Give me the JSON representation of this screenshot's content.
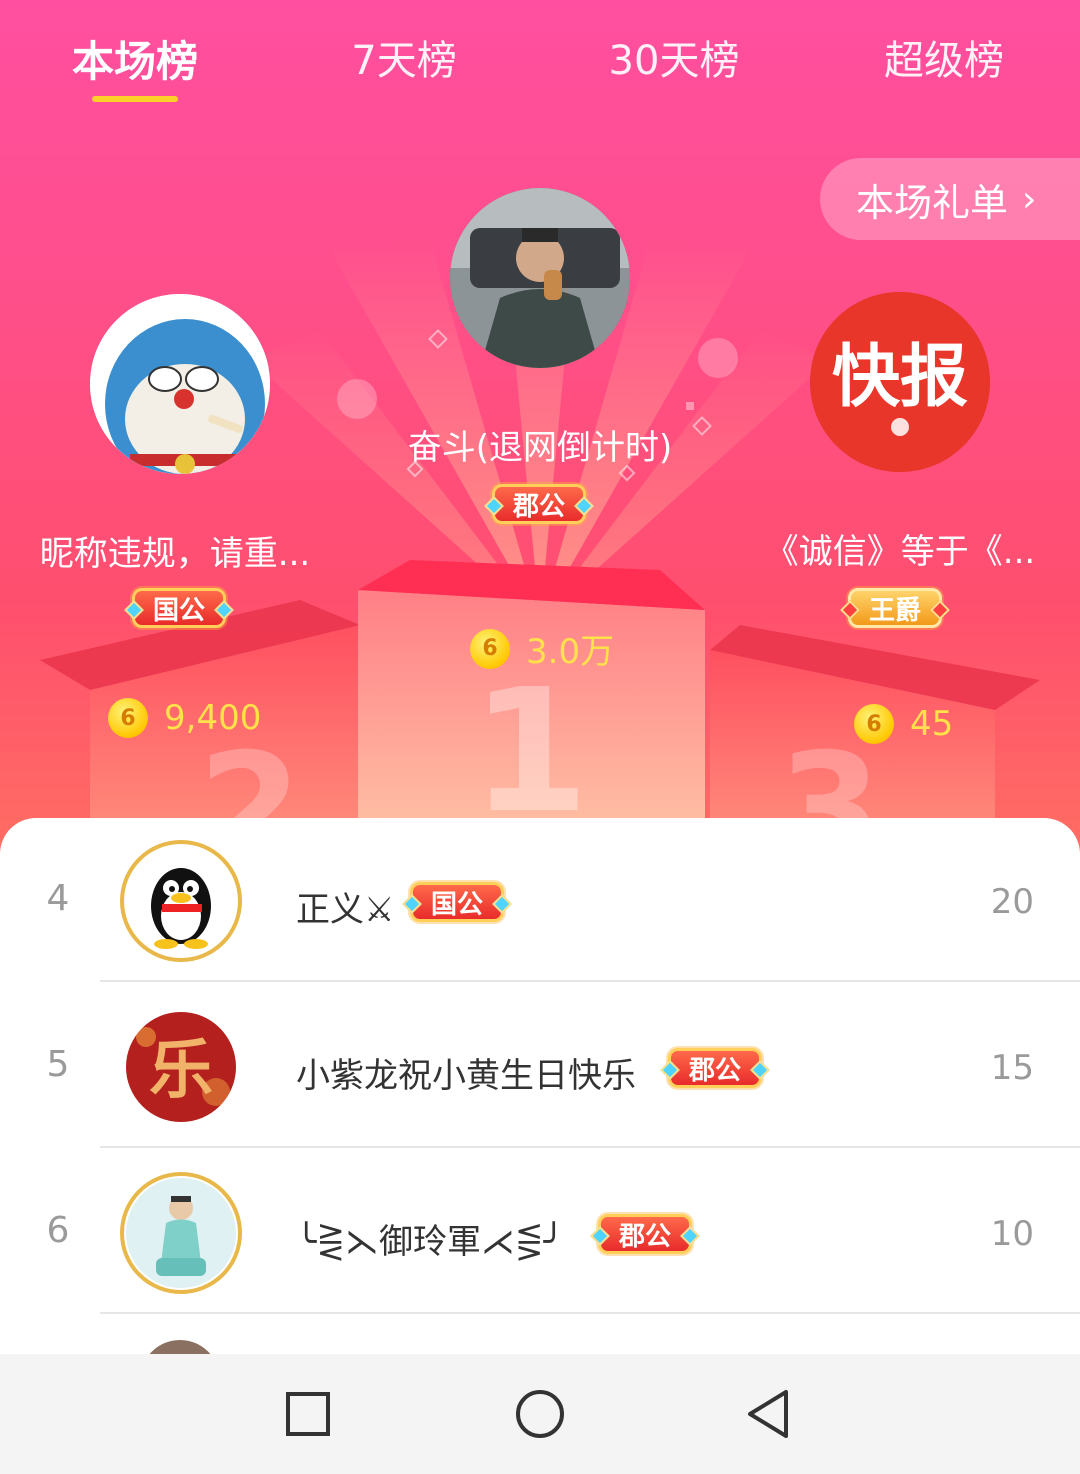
{
  "tabs": [
    {
      "label": "本场榜",
      "active": true
    },
    {
      "label": "7天榜",
      "active": false
    },
    {
      "label": "30天榜",
      "active": false
    },
    {
      "label": "超级榜",
      "active": false
    }
  ],
  "gift_list_button": {
    "label": "本场礼单",
    "icon": "chevron-right-icon"
  },
  "podium": {
    "first": {
      "rank": 1,
      "name": "奋斗(退网倒计时)",
      "badge": "郡公",
      "score": "3.0万"
    },
    "second": {
      "rank": 2,
      "name": "昵称违规，请重...",
      "badge": "国公",
      "score": "9,400"
    },
    "third": {
      "rank": 3,
      "name": "《诚信》等于《...",
      "badge": "王爵",
      "score": "45",
      "avatar_text": "快报"
    }
  },
  "list": [
    {
      "rank": "4",
      "name": "正义⚔",
      "badge": "国公",
      "score": "20"
    },
    {
      "rank": "5",
      "name": "小紫龙祝小黄生日快乐",
      "badge": "郡公",
      "score": "15",
      "avatar_text": "乐"
    },
    {
      "rank": "6",
      "name": "╰⋛⋋御玲軍⋌⋚╯",
      "badge": "郡公",
      "score": "10"
    }
  ],
  "colors": {
    "accent": "#ffd02a",
    "hero_top": "#ff4fa0",
    "hero_bottom": "#ff6e62",
    "coin": "#ffc800"
  },
  "navbar": [
    "recents-square-icon",
    "home-circle-icon",
    "back-triangle-icon"
  ]
}
